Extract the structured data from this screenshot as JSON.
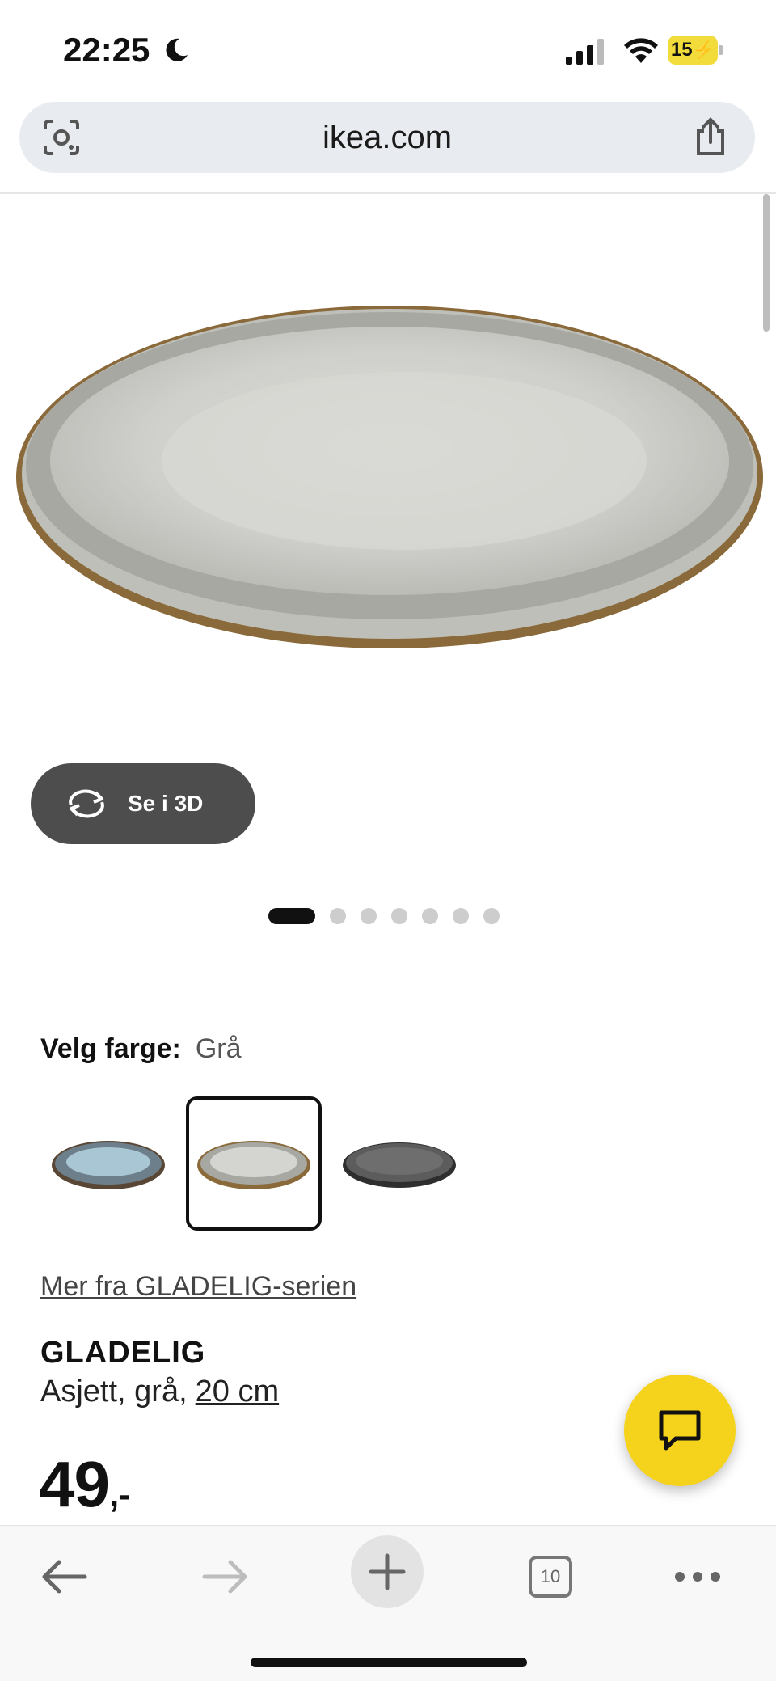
{
  "status_bar": {
    "time": "22:25",
    "battery": "15"
  },
  "browser": {
    "url": "ikea.com",
    "open_tabs": "10"
  },
  "product": {
    "view_3d_label": "Se i 3D",
    "image_count": 7,
    "active_image_index": 0,
    "color_label": "Velg farge:",
    "color_value": "Grå",
    "color_options": [
      {
        "name": "blue-brown-plate"
      },
      {
        "name": "grey-plate",
        "selected": true
      },
      {
        "name": "dark-grey-plate"
      }
    ],
    "series_link": "Mer fra GLADELIG-serien",
    "name": "GLADELIG",
    "description": "Asjett, grå,",
    "size": "20 cm",
    "price": "49",
    "price_suffix": ",-"
  },
  "icons": {
    "lens": "visual-search-icon",
    "share": "share-icon",
    "rotate": "rotate-3d-icon",
    "chat": "chat-icon",
    "back": "back-arrow-icon",
    "forward": "forward-arrow-icon",
    "new_tab": "plus-icon",
    "tabs": "tabs-icon",
    "more": "more-icon"
  },
  "colors": {
    "ikea_yellow": "#f5d21c",
    "button_dark": "#4d4d4d"
  }
}
